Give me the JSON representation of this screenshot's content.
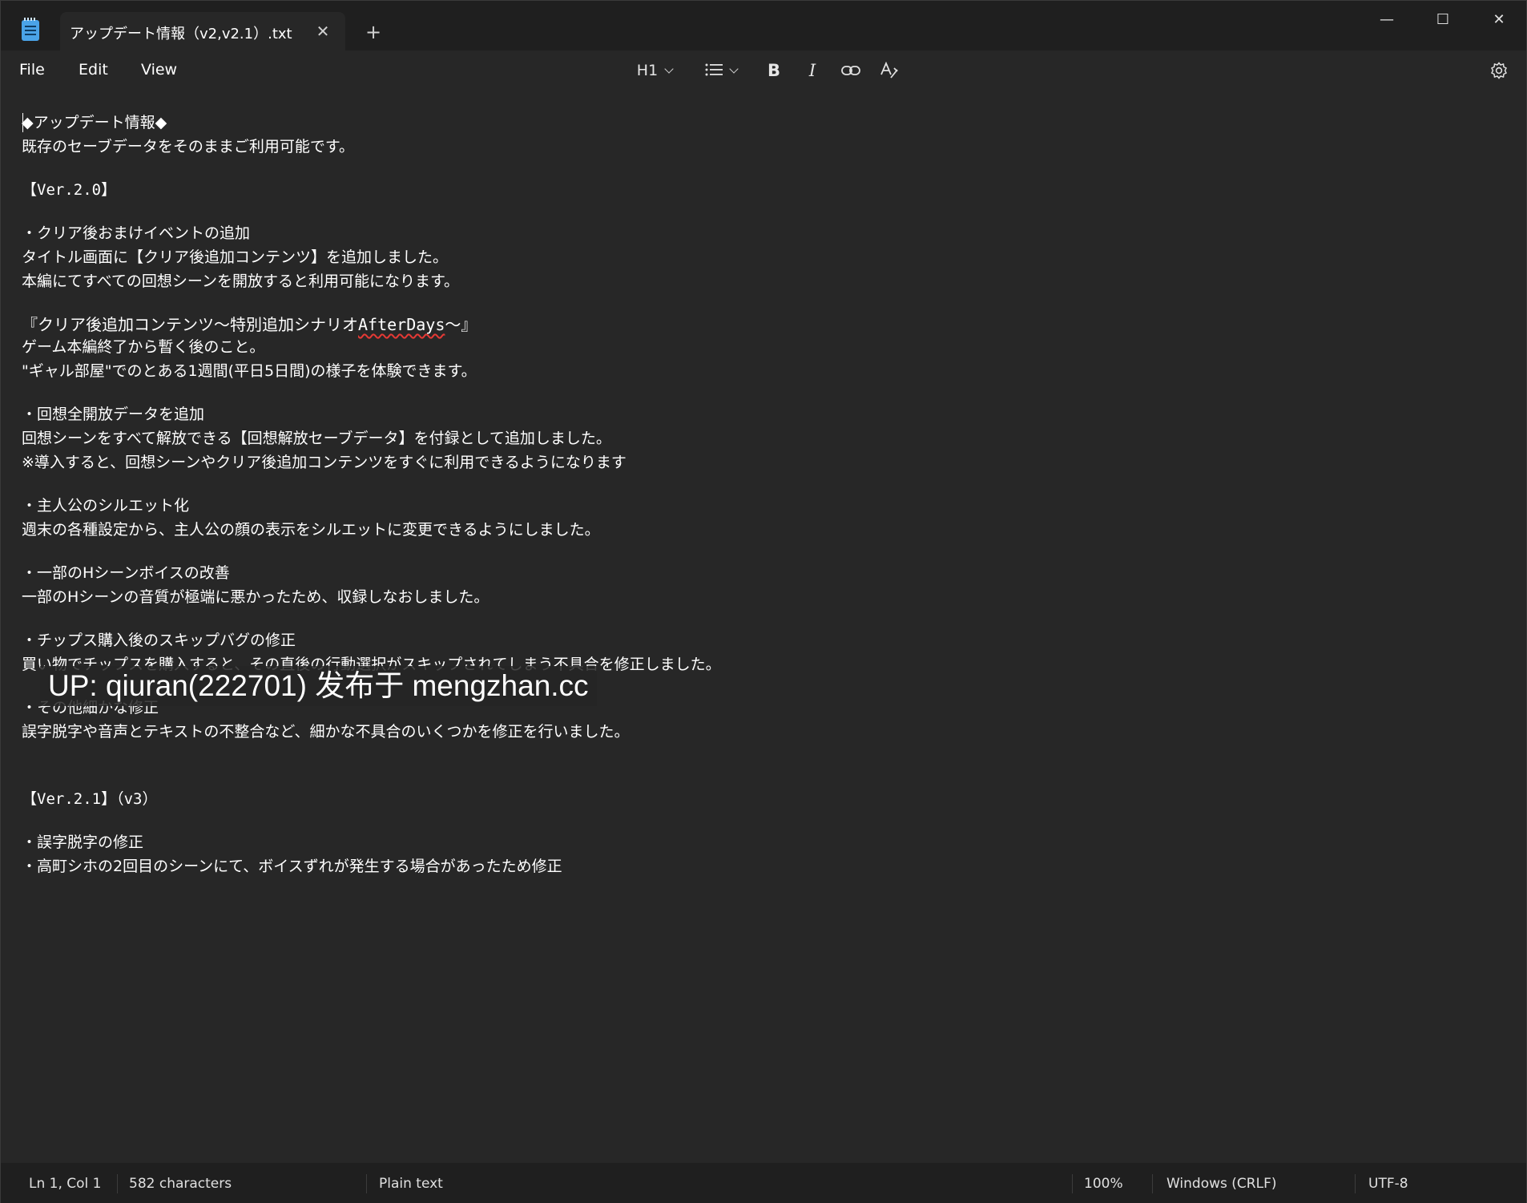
{
  "window": {
    "tab_title": "アップデート情報（v2,v2.1）.txt",
    "close_tab_glyph": "✕",
    "new_tab_glyph": "+",
    "minimize_glyph": "—",
    "maximize_glyph": "☐",
    "close_glyph": "✕"
  },
  "menu": {
    "file": "File",
    "edit": "Edit",
    "view": "View"
  },
  "toolbar": {
    "heading": "H1",
    "list_icon": "list-icon",
    "bold": "B",
    "italic": "I",
    "link_icon": "link-icon",
    "clear_format_icon": "clear-formatting-icon",
    "settings_icon": "gear-icon"
  },
  "document": {
    "lines": [
      "◆アップデート情報◆",
      "既存のセーブデータをそのままご利用可能です。",
      "【Ver.2.0】",
      "・クリア後おまけイベントの追加",
      "タイトル画面に【クリア後追加コンテンツ】を追加しました。",
      "本編にてすべての回想シーンを開放すると利用可能になります。",
      "『クリア後追加コンテンツ～特別追加シナリオ",
      "AfterDays",
      "～』",
      "ゲーム本編終了から暫く後のこと。",
      "\"ギャル部屋\"でのとある1週間(平日5日間)の様子を体験できます。",
      "・回想全開放データを追加",
      "回想シーンをすべて解放できる【回想解放セーブデータ】を付録として追加しました。",
      "※導入すると、回想シーンやクリア後追加コンテンツをすぐに利用できるようになります",
      "・主人公のシルエット化",
      "週末の各種設定から、主人公の顔の表示をシルエットに変更できるようにしました。",
      "・一部のHシーンボイスの改善",
      "一部のHシーンの音質が極端に悪かったため、収録しなおしました。",
      "・チップス購入後のスキップバグの修正",
      "買い物でチップスを購入すると、その直後の行動選択がスキップされてしまう不具合を修正しました。",
      "・その他細かな修正",
      "誤字脱字や音声とテキストの不整合など、細かな不具合のいくつかを修正を行いました。",
      "【Ver.2.1】（v3）",
      "・誤字脱字の修正",
      "・高町シホの2回目のシーンにて、ボイスずれが発生する場合があったため修正"
    ],
    "watermark": "UP: qiuran(222701) 发布于 mengzhan.cc"
  },
  "status": {
    "position": "Ln 1, Col 1",
    "characters": "582 characters",
    "format": "Plain text",
    "zoom": "100%",
    "line_endings": "Windows (CRLF)",
    "encoding": "UTF-8"
  }
}
